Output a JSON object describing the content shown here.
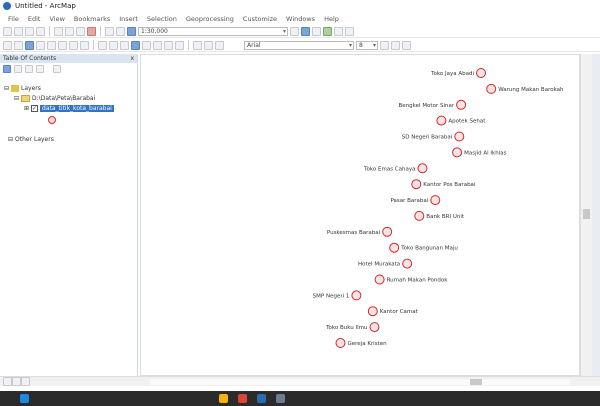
{
  "app": {
    "title": "Untitled - ArcMap"
  },
  "menu": [
    "File",
    "Edit",
    "View",
    "Bookmarks",
    "Insert",
    "Selection",
    "Geoprocessing",
    "Customize",
    "Windows",
    "Help"
  ],
  "toolbar": {
    "scale_value": "1:30,000",
    "font_value": "Arial",
    "font_size": "8"
  },
  "toc": {
    "header_title": "Table Of Contents",
    "close_label": "x",
    "layers_label": "Layers",
    "group_label": "D:\\Data\\Peta\\Barabai",
    "layer_label": "data_titik_kota_barabai",
    "other_label": "Other Layers"
  },
  "colors": {
    "accent": "#3572c4",
    "point": "#cc2b2b"
  },
  "map_points": [
    {
      "label": "Toko Jaya Abadi",
      "cluster": "north"
    },
    {
      "label": "Warung Makan Barokah",
      "cluster": "north"
    },
    {
      "label": "Bengkel Motor Sinar",
      "cluster": "north"
    },
    {
      "label": "Apotek Sehat",
      "cluster": "north"
    },
    {
      "label": "SD Negeri Barabai",
      "cluster": "north"
    },
    {
      "label": "Masjid Al Ikhlas",
      "cluster": "north"
    },
    {
      "label": "Toko Emas Cahaya",
      "cluster": "middle"
    },
    {
      "label": "Kantor Pos Barabai",
      "cluster": "middle"
    },
    {
      "label": "Pasar Barabai",
      "cluster": "middle"
    },
    {
      "label": "Bank BRI Unit",
      "cluster": "middle"
    },
    {
      "label": "Puskesmas Barabai",
      "cluster": "middle"
    },
    {
      "label": "Toko Bangunan Maju",
      "cluster": "middle"
    },
    {
      "label": "Hotel Murakata",
      "cluster": "south"
    },
    {
      "label": "Rumah Makan Pondok",
      "cluster": "south"
    },
    {
      "label": "SMP Negeri 1",
      "cluster": "south"
    },
    {
      "label": "Kantor Camat",
      "cluster": "south"
    },
    {
      "label": "Toko Buku Ilmu",
      "cluster": "south"
    },
    {
      "label": "Gereja Kristen",
      "cluster": "south"
    }
  ]
}
